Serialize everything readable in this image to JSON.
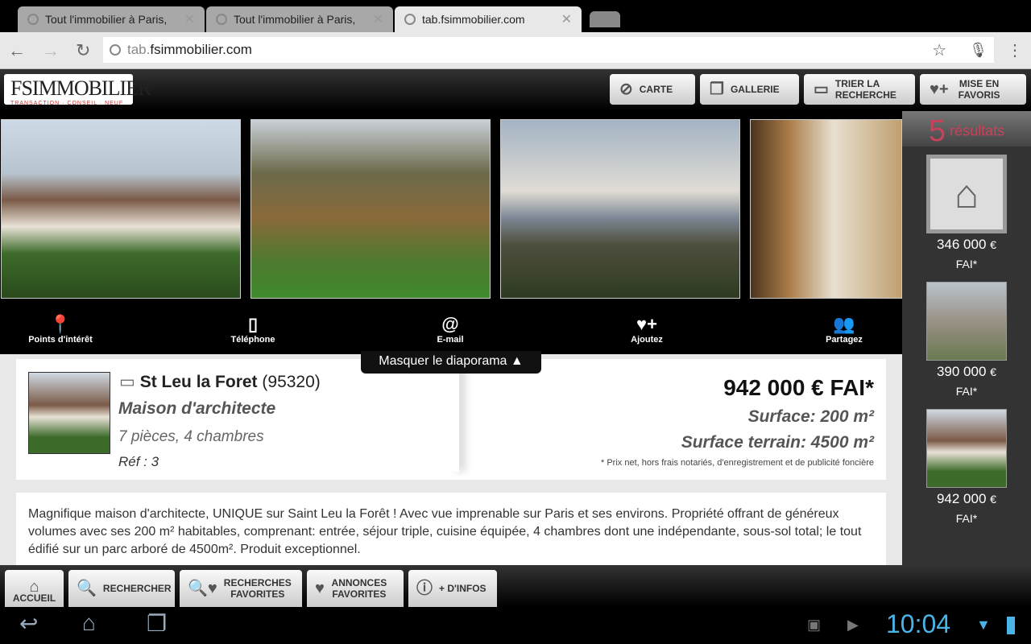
{
  "browser": {
    "tabs": [
      {
        "title": "Tout l'immobilier à Paris,",
        "active": false
      },
      {
        "title": "Tout l'immobilier à Paris,",
        "active": false
      },
      {
        "title": "tab.fsimmobilier.com",
        "active": true
      }
    ],
    "url_prefix": "tab.",
    "url_domain": "fsimmobilier.com"
  },
  "logo": {
    "name": "FSIMMOBILIER",
    "tagline": "TRANSACTION · CONSEIL · NEUF"
  },
  "header_buttons": [
    {
      "label": "CARTE",
      "icon": "compass-icon"
    },
    {
      "label": "GALLERIE",
      "icon": "gallery-icon"
    },
    {
      "label": "TRIER LA RECHERCHE",
      "icon": "sort-icon"
    },
    {
      "label": "MISE EN FAVORIS",
      "icon": "heart-plus-icon"
    }
  ],
  "actions": [
    {
      "label": "Points d'intérêt",
      "icon": "map-pin-icon"
    },
    {
      "label": "Téléphone",
      "icon": "phone-icon"
    },
    {
      "label": "E-mail",
      "icon": "at-icon"
    },
    {
      "label": "Ajoutez",
      "icon": "heart-plus-icon"
    },
    {
      "label": "Partagez",
      "icon": "people-icon"
    }
  ],
  "toggle_label": "Masquer le diaporama",
  "listing": {
    "city": "St Leu la Foret",
    "postcode": "(95320)",
    "type": "Maison d'architecte",
    "rooms": "7 pièces, 4 chambres",
    "ref": "Réf : 3",
    "price": "942 000 € FAI*",
    "surface": "Surface: 200 m²",
    "terrain": "Surface terrain: 4500 m²",
    "note": "* Prix net, hors frais notariés, d'enregistrement et de publicité foncière",
    "description": "Magnifique maison d'architecte, UNIQUE sur Saint Leu la Forêt ! Avec vue imprenable sur Paris et ses environs. Propriété offrant de généreux volumes avec ses 200 m² habitables, comprenant: entrée, séjour triple, cuisine équipée, 4 chambres dont une indépendante, sous-sol total; le tout édifié sur un parc arboré de 4500m². Produit exceptionnel."
  },
  "sidebar": {
    "count": "5",
    "count_label": "résultats",
    "results": [
      {
        "price": "346 000",
        "currency": "€",
        "suffix": "FAI*"
      },
      {
        "price": "390 000",
        "currency": "€",
        "suffix": "FAI*"
      },
      {
        "price": "942 000",
        "currency": "€",
        "suffix": "FAI*"
      }
    ]
  },
  "bottom_nav": [
    {
      "label": "ACCUEIL",
      "icon": "home-icon"
    },
    {
      "label": "RECHERCHER",
      "icon": "search-icon"
    },
    {
      "label": "RECHERCHES FAVORITES",
      "icon": "search-heart-icon"
    },
    {
      "label": "ANNONCES FAVORITES",
      "icon": "heart-icon"
    },
    {
      "label": "+ D'INFOS",
      "icon": "info-icon"
    }
  ],
  "system": {
    "time": "10:04"
  }
}
